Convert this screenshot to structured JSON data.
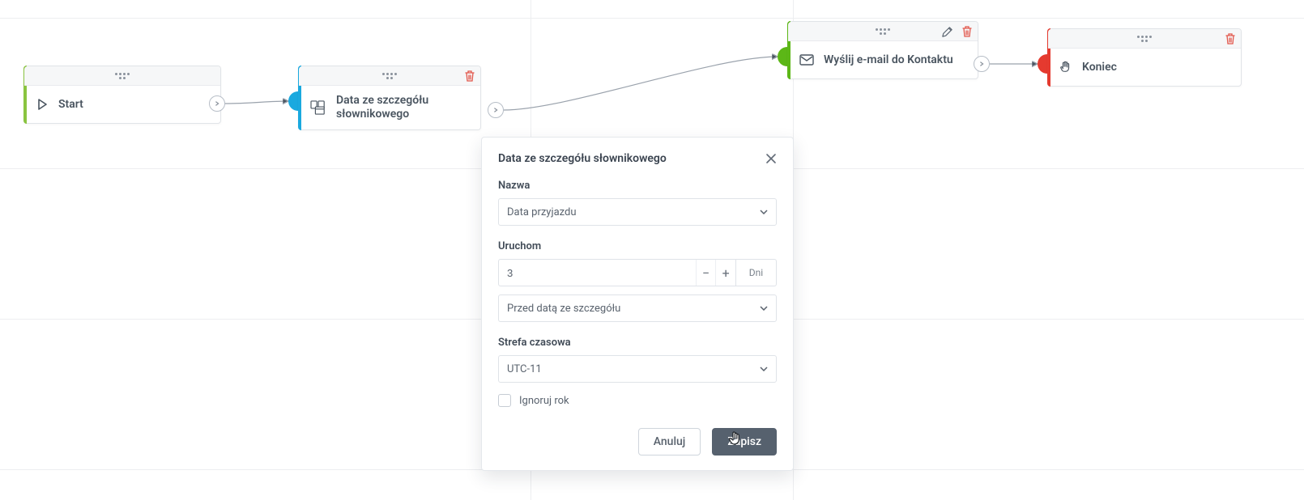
{
  "nodes": {
    "start": {
      "label": "Start"
    },
    "date": {
      "label": "Data ze szczegółu słownikowego"
    },
    "email": {
      "label": "Wyślij e-mail do Kontaktu"
    },
    "end": {
      "label": "Koniec"
    }
  },
  "popover": {
    "title": "Data ze szczegółu słownikowego",
    "name_label": "Nazwa",
    "name_value": "Data przyjazdu",
    "run_label": "Uruchom",
    "run_value": "3",
    "run_unit": "Dni",
    "relation_value": "Przed datą ze szczegółu",
    "timezone_label": "Strefa czasowa",
    "timezone_value": "UTC-11",
    "ignore_year_label": "Ignoruj rok",
    "cancel": "Anuluj",
    "save": "Zapisz"
  },
  "colors": {
    "start": "#8ac440",
    "date": "#1aa9df",
    "email": "#5cb717",
    "end": "#e53a2f"
  }
}
